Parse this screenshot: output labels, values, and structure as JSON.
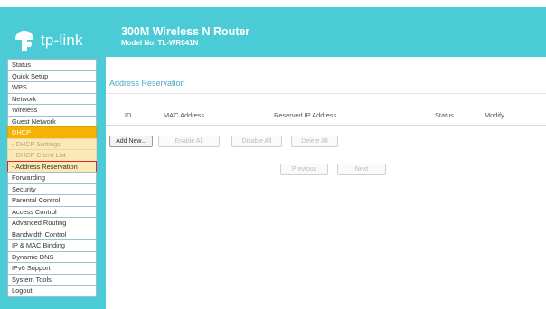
{
  "brand": {
    "logo_text": "tp-link",
    "logo_icon": "tp-link-logo-icon"
  },
  "header": {
    "title": "300M Wireless N Router",
    "model": "Model No. TL-WR841N"
  },
  "sidebar": {
    "items": [
      {
        "label": "Status"
      },
      {
        "label": "Quick Setup"
      },
      {
        "label": "WPS"
      },
      {
        "label": "Network"
      },
      {
        "label": "Wireless"
      },
      {
        "label": "Guest Network"
      },
      {
        "label": "DHCP"
      },
      {
        "label": "- DHCP Settings"
      },
      {
        "label": "- DHCP Client List"
      },
      {
        "label": "- Address Reservation"
      },
      {
        "label": "Forwarding"
      },
      {
        "label": "Security"
      },
      {
        "label": "Parental Control"
      },
      {
        "label": "Access Control"
      },
      {
        "label": "Advanced Routing"
      },
      {
        "label": "Bandwidth Control"
      },
      {
        "label": "IP & MAC Binding"
      },
      {
        "label": "Dynamic DNS"
      },
      {
        "label": "IPv6 Support"
      },
      {
        "label": "System Tools"
      },
      {
        "label": "Logout"
      }
    ]
  },
  "main": {
    "section_title": "Address Reservation",
    "table_headers": [
      "ID",
      "MAC Address",
      "Reserved IP Address",
      "Status",
      "Modify"
    ],
    "buttons": {
      "add_new": "Add New...",
      "enable_all": "Enable All",
      "disable_all": "Disable All",
      "delete_all": "Delete All",
      "previous": "Previous",
      "next": "Next"
    }
  },
  "colors": {
    "header_bg": "#4acbd6",
    "active_menu": "#f6b200",
    "submenu_bg": "#fde9b6",
    "selected_outline": "#e32330",
    "section_title": "#4aa8c9"
  }
}
